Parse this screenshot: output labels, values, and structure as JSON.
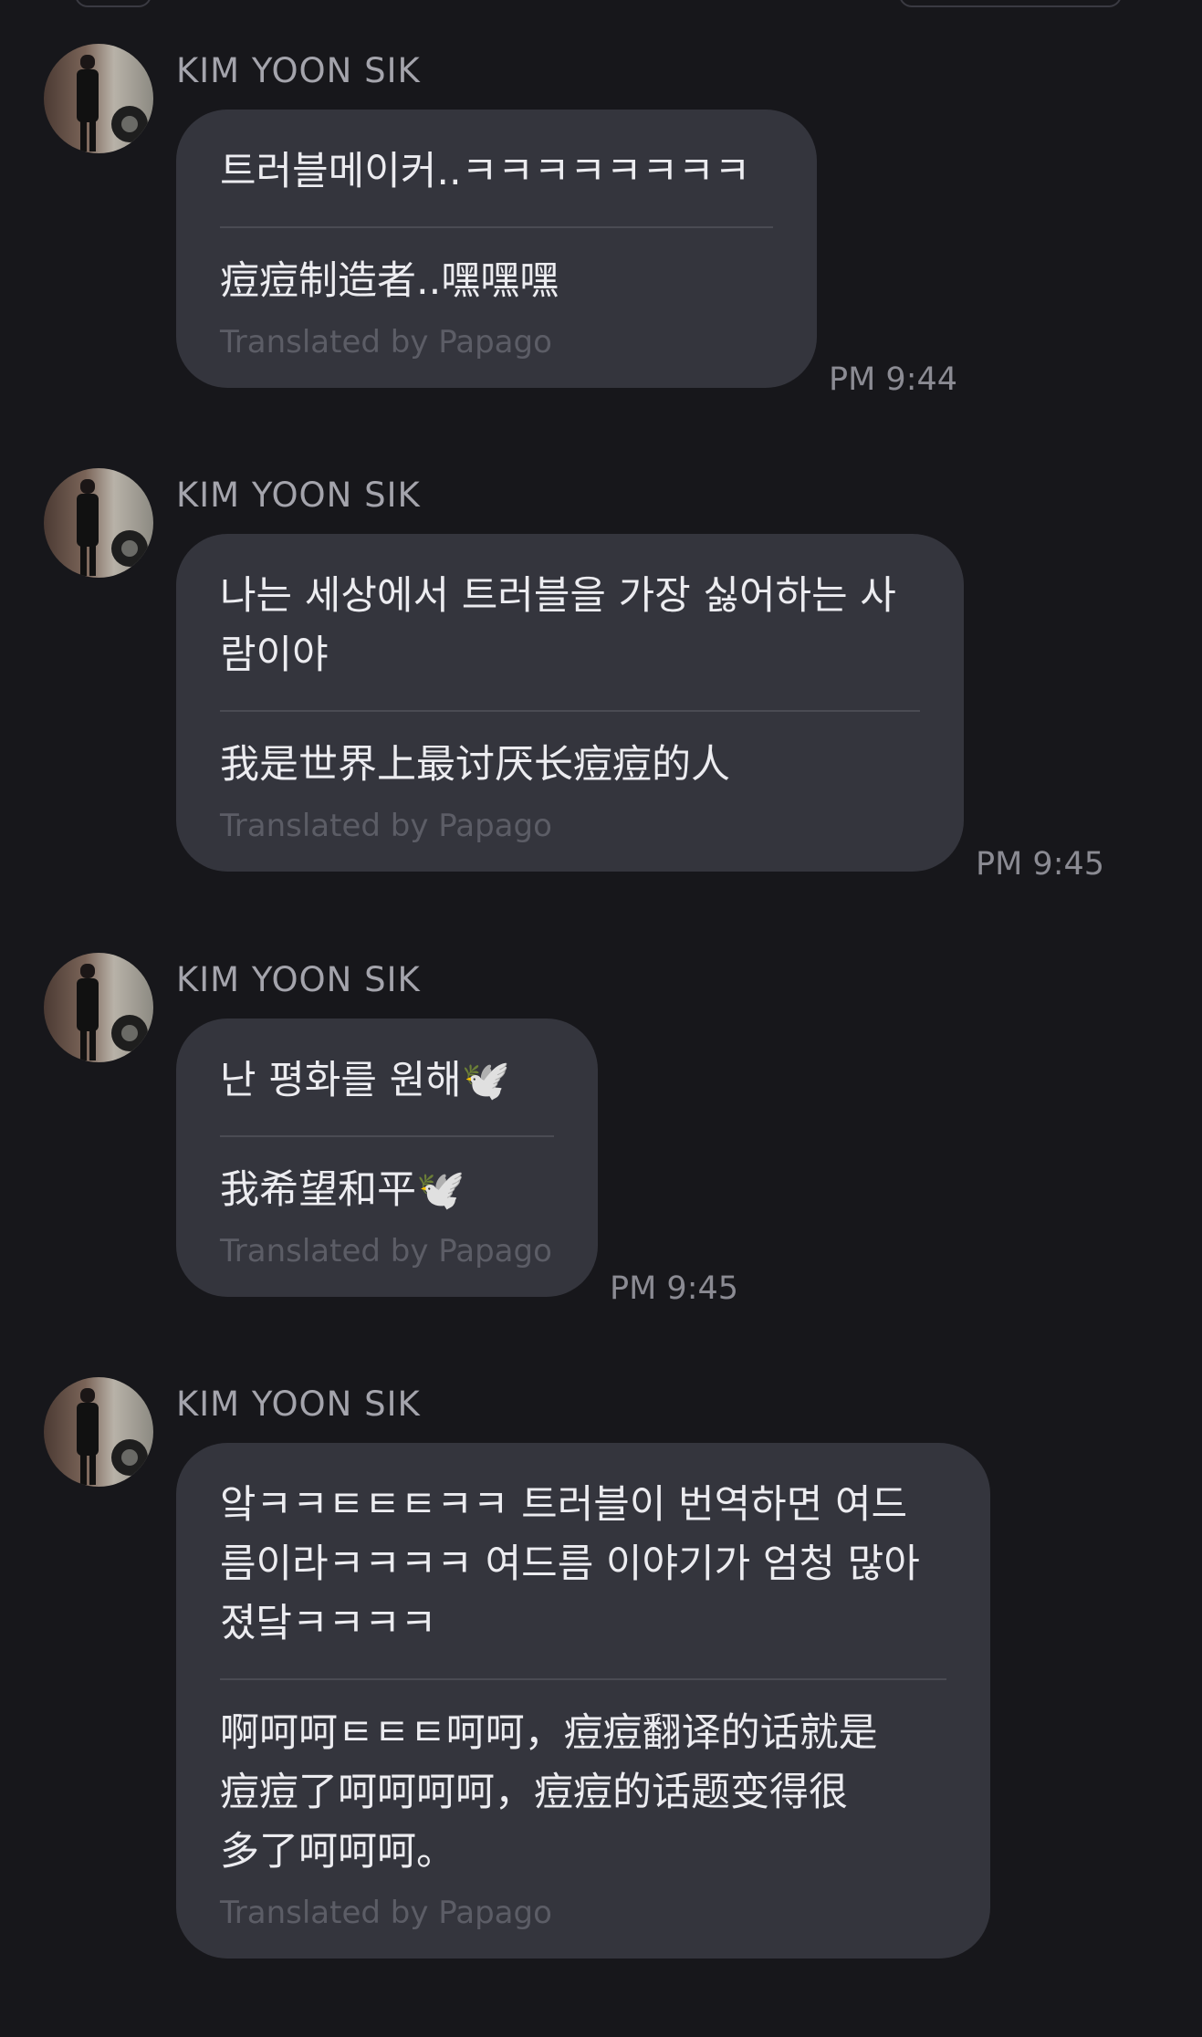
{
  "messages": [
    {
      "sender": "KIM YOON SIK",
      "original": "트러블메이커..ㅋㅋㅋㅋㅋㅋㅋㅋ",
      "translation": "痘痘制造者..嘿嘿嘿",
      "translated_by": "Translated by Papago",
      "time": "PM 9:44"
    },
    {
      "sender": "KIM YOON SIK",
      "original": "나는 세상에서 트러블을 가장 싫어하는 사\n람이야",
      "translation": "我是世界上最讨厌长痘痘的人",
      "translated_by": "Translated by Papago",
      "time": "PM 9:45"
    },
    {
      "sender": "KIM YOON SIK",
      "original": "난 평화를 원해🕊️",
      "translation": "我希望和平🕊️",
      "translated_by": "Translated by Papago",
      "time": "PM 9:45"
    },
    {
      "sender": "KIM YOON SIK",
      "original": "앜ㅋㅋㅌㅌㅌㅋㅋ 트러블이 번역하면 여드\n름이라ㅋㅋㅋㅋ 여드름 이야기가 엄청 많아\n졌닼ㅋㅋㅋㅋ",
      "translation": "啊呵呵ㅌㅌㅌ呵呵，痘痘翻译的话就是\n痘痘了呵呵呵呵，痘痘的话题变得很\n多了呵呵呵。",
      "translated_by": "Translated by Papago"
    }
  ]
}
